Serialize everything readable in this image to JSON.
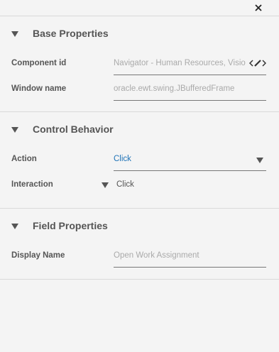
{
  "sections": {
    "base": {
      "title": "Base Properties",
      "component_id": {
        "label": "Component id",
        "value": "Navigator - Human Resources, Visio"
      },
      "window_name": {
        "label": "Window name",
        "value": "oracle.ewt.swing.JBufferedFrame"
      }
    },
    "control": {
      "title": "Control Behavior",
      "action": {
        "label": "Action",
        "value": "Click"
      },
      "interaction": {
        "label": "Interaction",
        "value": "Click"
      }
    },
    "field": {
      "title": "Field Properties",
      "display_name": {
        "label": "Display Name",
        "placeholder": "Open Work Assignment"
      }
    }
  },
  "icons": {
    "close": "close-icon",
    "collapse": "triangle-down-icon",
    "edit": "edit-icon",
    "dropdown": "triangle-down-icon"
  },
  "colors": {
    "background": "#f4f4f4",
    "accent_text": "#1f73b7",
    "divider": "#d9d9d9"
  }
}
